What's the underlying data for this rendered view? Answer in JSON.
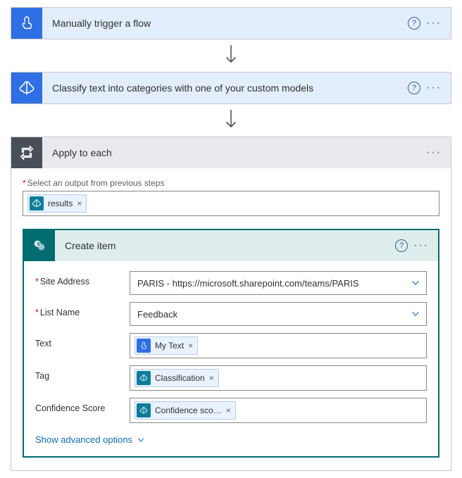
{
  "step1": {
    "title": "Manually trigger a flow"
  },
  "step2": {
    "title": "Classify text into categories with one of your custom models"
  },
  "applyEach": {
    "title": "Apply to each",
    "selectLabel": "Select an output from previous steps",
    "token": "results"
  },
  "createItem": {
    "title": "Create item",
    "fields": {
      "siteAddress": {
        "label": "Site Address",
        "value": "PARIS - https://microsoft.sharepoint.com/teams/PARIS"
      },
      "listName": {
        "label": "List Name",
        "value": "Feedback"
      },
      "text": {
        "label": "Text",
        "token": "My Text"
      },
      "tag": {
        "label": "Tag",
        "token": "Classification"
      },
      "confidence": {
        "label": "Confidence Score",
        "token": "Confidence sco…"
      }
    },
    "advanced": "Show advanced options"
  }
}
